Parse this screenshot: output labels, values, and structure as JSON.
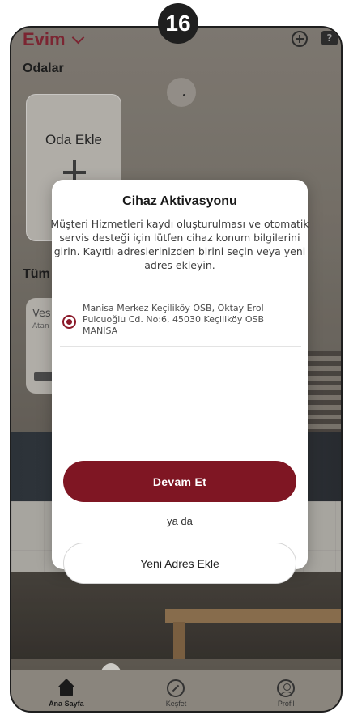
{
  "step": {
    "number": "16"
  },
  "header": {
    "title": "Evim",
    "add_icon": "plus-circle-icon",
    "help_icon": "help-icon"
  },
  "rooms": {
    "section_title": "Odalar",
    "add_room_label": "Oda Ekle"
  },
  "devices": {
    "section_title": "Tüm",
    "device_name": "Ves",
    "device_subtitle": "Atan"
  },
  "modal": {
    "title": "Cihaz Aktivasyonu",
    "description": "Müşteri Hizmetleri kaydı oluşturulması ve otomatik servis desteği için lütfen cihaz konum bilgilerini girin. Kayıtlı adreslerinizden birini seçin veya yeni adres ekleyin.",
    "address": {
      "text": "Manisa Merkez Keçiliköy OSB, Oktay Erol Pulcuoğlu Cd. No:6, 45030 Keçiliköy OSB MANİSA",
      "selected": true
    },
    "continue_label": "Devam Et",
    "or_label": "ya da",
    "new_address_label": "Yeni Adres Ekle"
  },
  "bottom_nav": {
    "items": [
      {
        "label": "Ana Sayfa",
        "icon": "home-icon",
        "active": true
      },
      {
        "label": "Keşfet",
        "icon": "compass-icon",
        "active": false
      },
      {
        "label": "Profil",
        "icon": "profile-icon",
        "active": false
      }
    ]
  },
  "colors": {
    "accent": "#7f1623",
    "brand_title": "#8d2b3a"
  }
}
